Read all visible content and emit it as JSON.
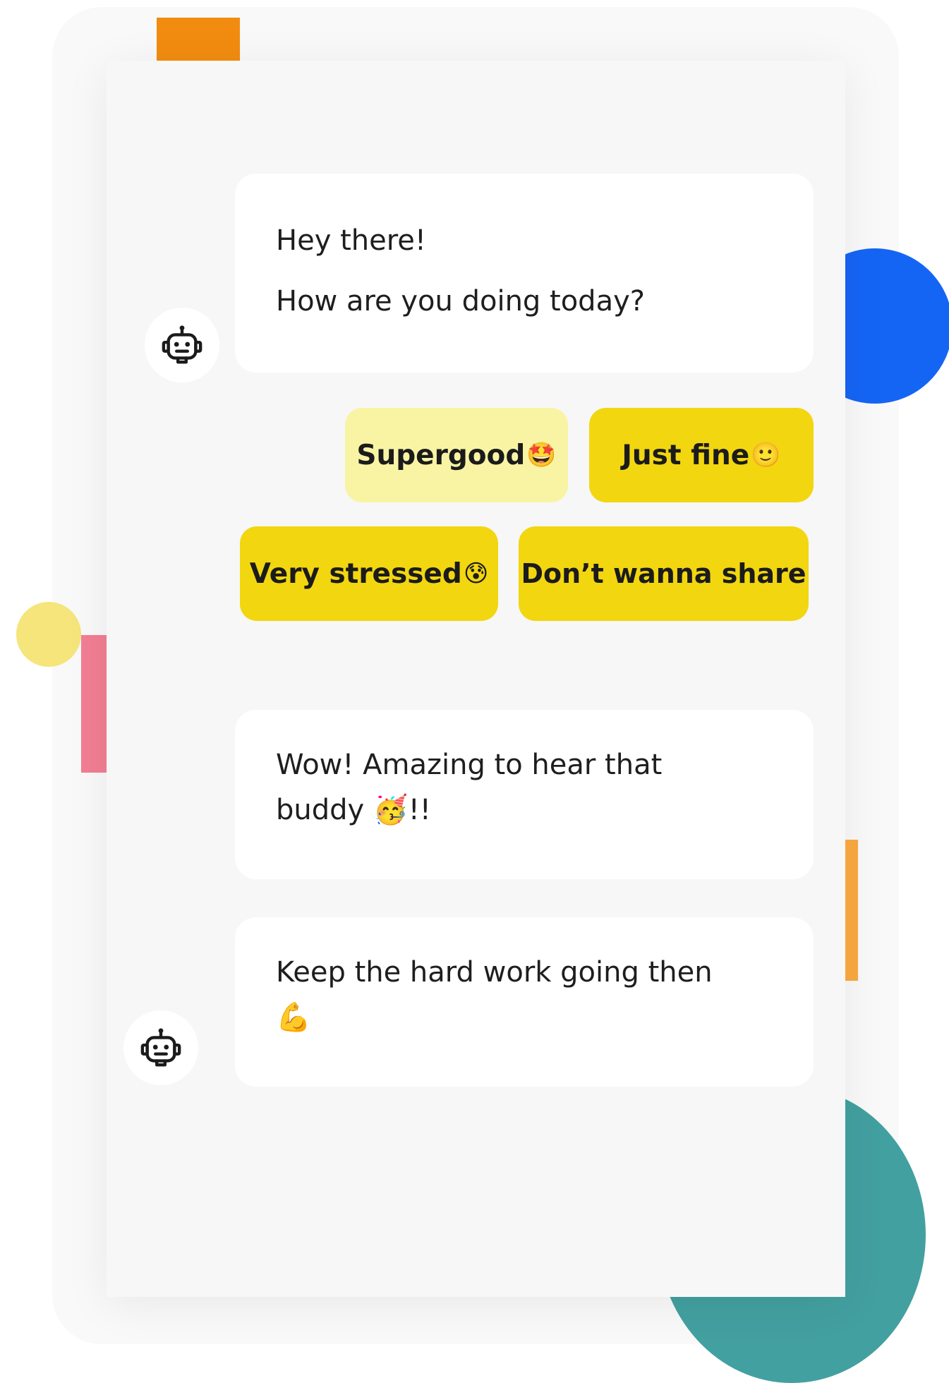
{
  "colors": {
    "background_card": "#f9f9f9",
    "chat_panel": "#f7f7f7",
    "bubble": "#ffffff",
    "reply_button": "#f2d610",
    "reply_button_selected": "#f8f4a4",
    "deco_orange": "#f28c10",
    "deco_blue": "#1565f5",
    "deco_yellow": "#f5e57a",
    "deco_pink": "#f27e94",
    "deco_orange_bar": "#f5a53e",
    "deco_teal": "#43a0a0"
  },
  "conversation": {
    "bot_icon": "robot-icon",
    "message_1": {
      "line_1": "Hey there!",
      "line_2": "How are you doing today?"
    },
    "quick_replies": [
      {
        "label": "Supergood",
        "emoji": "🤩",
        "selected": true
      },
      {
        "label": "Just fine",
        "emoji": "🙂",
        "selected": false
      },
      {
        "label": "Very stressed",
        "emoji": "😰",
        "selected": false
      },
      {
        "label": "Don’t wanna share",
        "emoji": "",
        "selected": false
      }
    ],
    "message_2": {
      "line_1": "Wow! Amazing to hear that",
      "line_2": "buddy 🥳!!"
    },
    "message_3": {
      "line_1": "Keep the hard work going then",
      "line_2": "💪"
    }
  }
}
